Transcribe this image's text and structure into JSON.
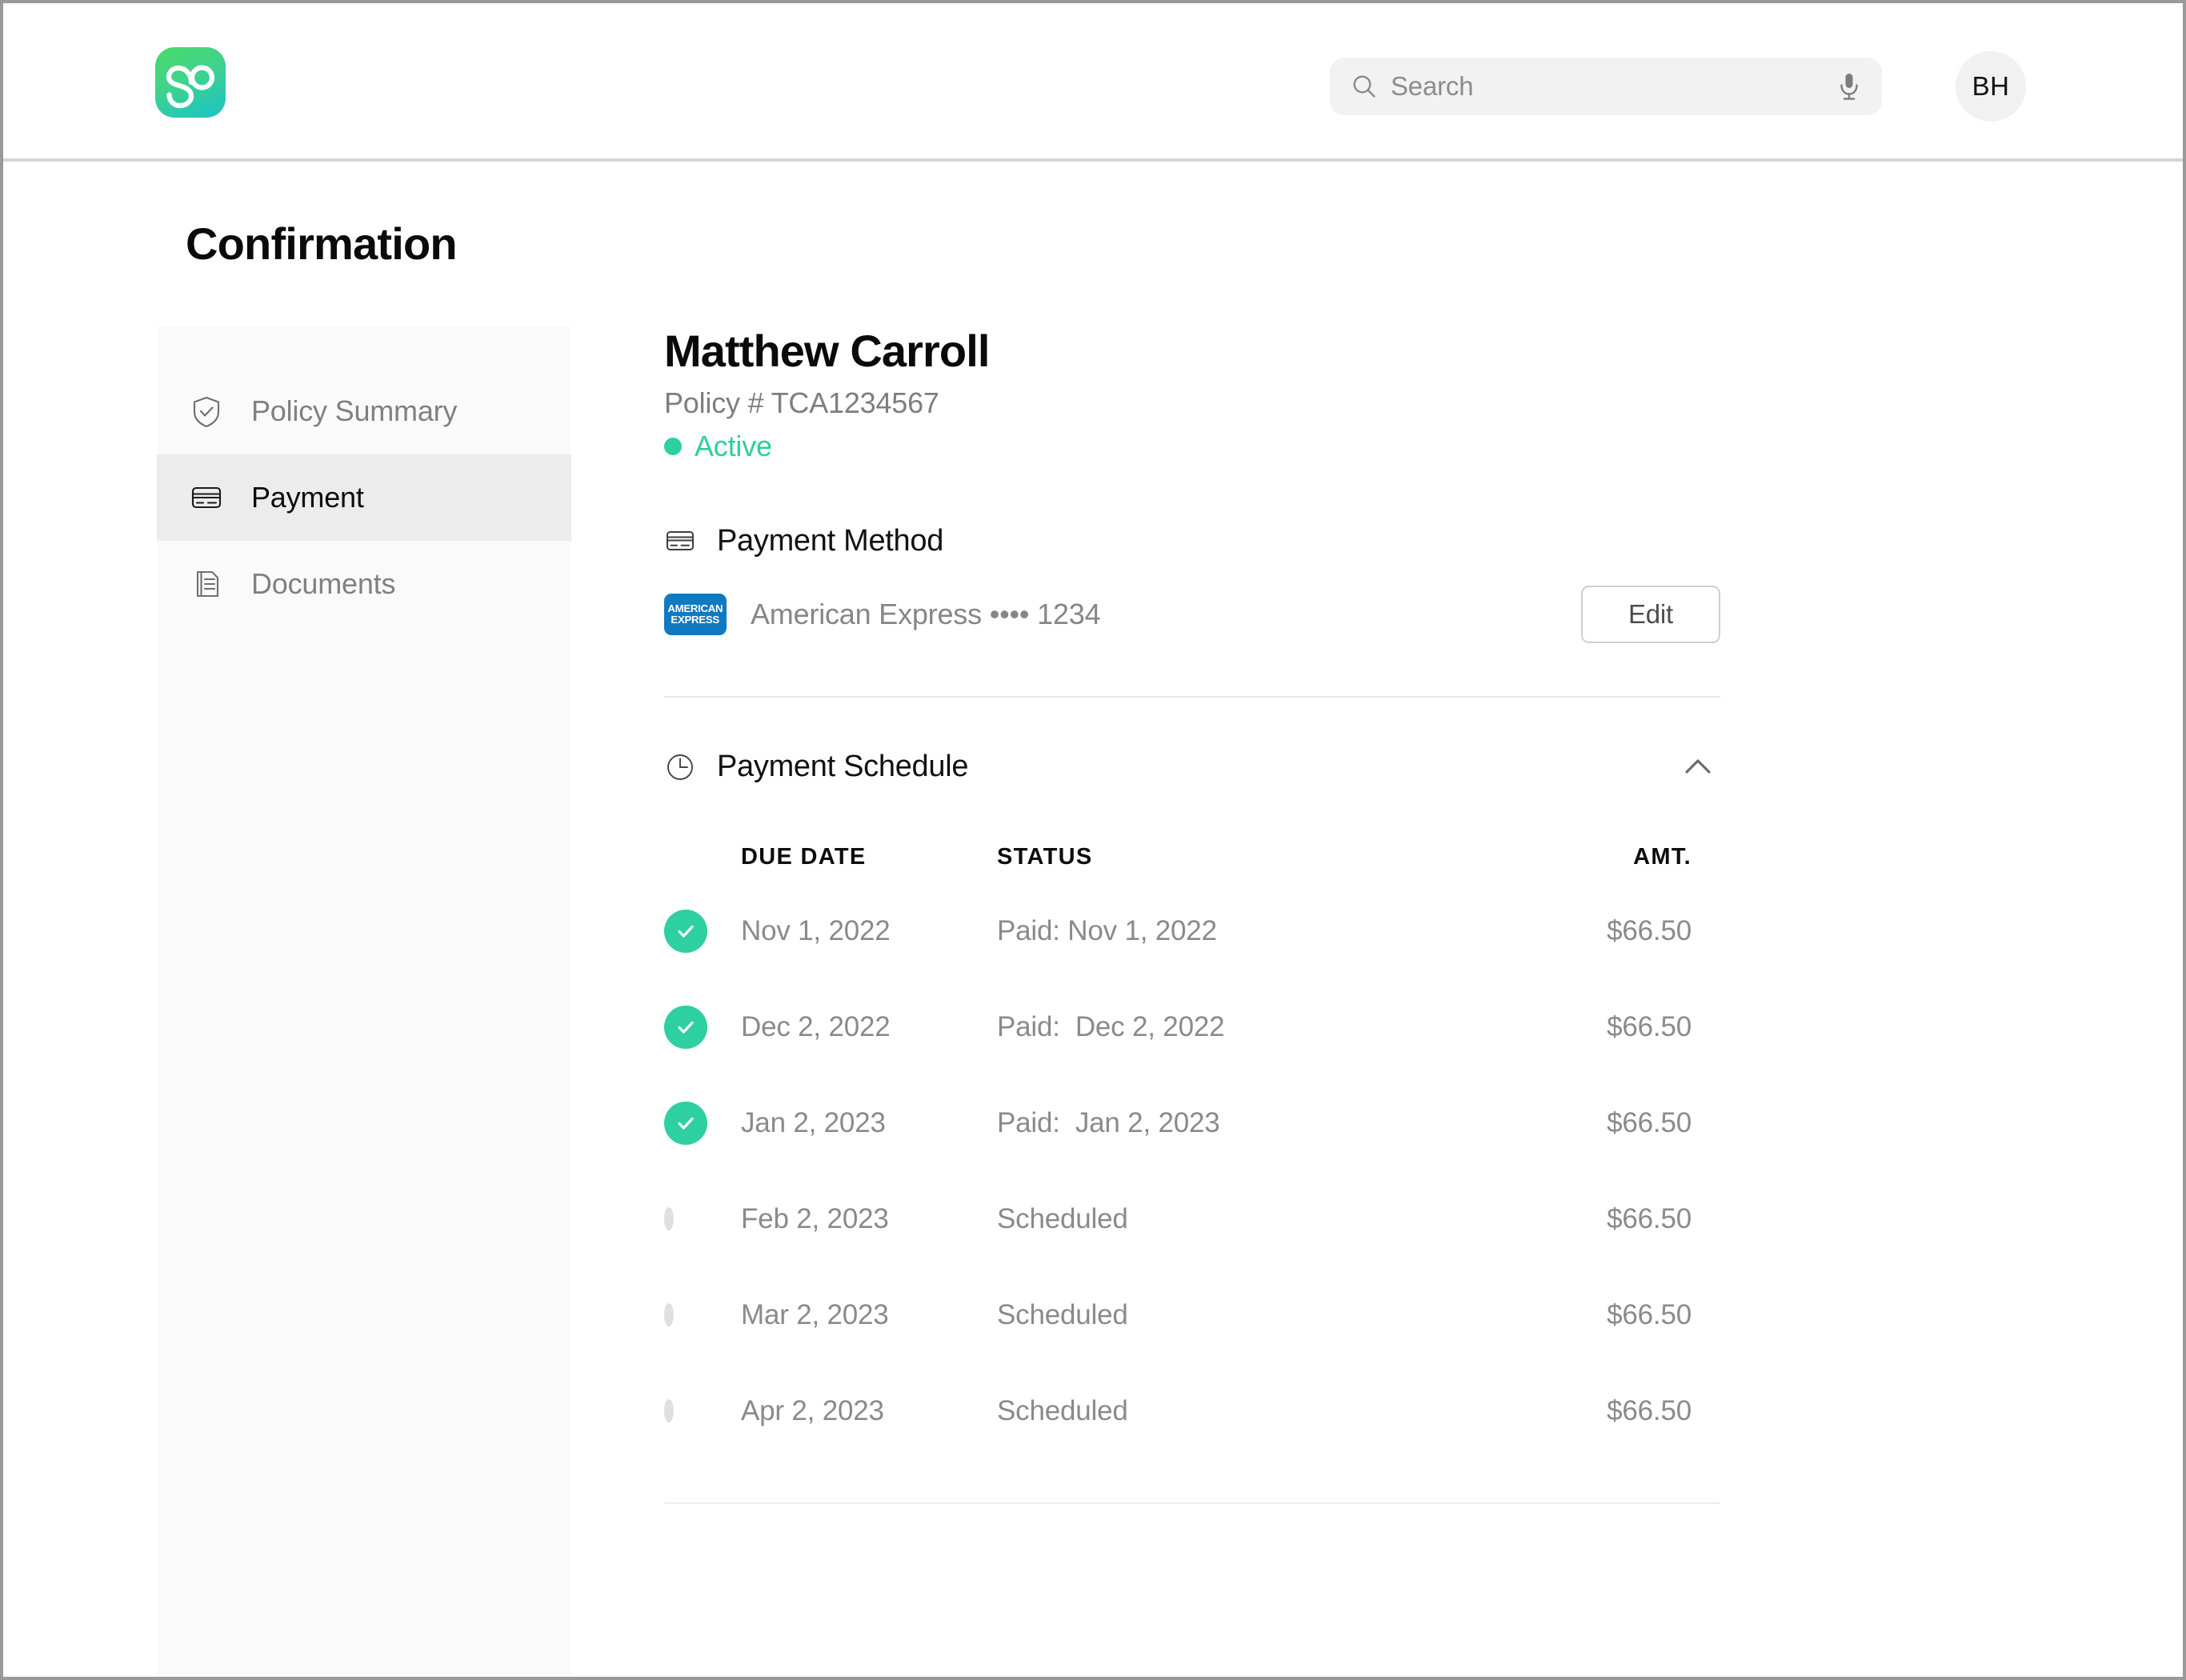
{
  "topbar": {
    "logo_name": "simplesurance-logo",
    "search": {
      "placeholder": "Search",
      "value": ""
    },
    "avatar_initials": "BH"
  },
  "page": {
    "title": "Confirmation"
  },
  "sidebar": {
    "items": [
      {
        "label": "Policy Summary",
        "icon": "shield-check-icon",
        "active": false
      },
      {
        "label": "Payment",
        "icon": "credit-card-icon",
        "active": true
      },
      {
        "label": "Documents",
        "icon": "documents-icon",
        "active": false
      }
    ]
  },
  "customer": {
    "name": "Matthew Carroll",
    "policy_number": "Policy # TCA1234567",
    "status": "Active",
    "status_color": "#2ecfa0"
  },
  "payment_method": {
    "section_title": "Payment Method",
    "card_brand_mark_line1": "AMERICAN",
    "card_brand_mark_line2": "EXPRESS",
    "card_brand_color": "#1179c1",
    "card_label": "American Express •••• 1234",
    "edit_label": "Edit"
  },
  "payment_schedule": {
    "section_title": "Payment Schedule",
    "collapsed": false,
    "columns": [
      "DUE DATE",
      "STATUS",
      "AMT."
    ],
    "rows": [
      {
        "paid": true,
        "due_date": "Nov 1, 2022",
        "status": "Paid: Nov 1, 2022",
        "amount": "$66.50"
      },
      {
        "paid": true,
        "due_date": "Dec 2, 2022",
        "status": "Paid:  Dec 2, 2022",
        "amount": "$66.50"
      },
      {
        "paid": true,
        "due_date": "Jan 2, 2023",
        "status": "Paid:  Jan 2, 2023",
        "amount": "$66.50"
      },
      {
        "paid": false,
        "due_date": "Feb 2, 2023",
        "status": "Scheduled",
        "amount": "$66.50"
      },
      {
        "paid": false,
        "due_date": "Mar 2, 2023",
        "status": "Scheduled",
        "amount": "$66.50"
      },
      {
        "paid": false,
        "due_date": "Apr 2, 2023",
        "status": "Scheduled",
        "amount": "$66.50"
      }
    ]
  }
}
